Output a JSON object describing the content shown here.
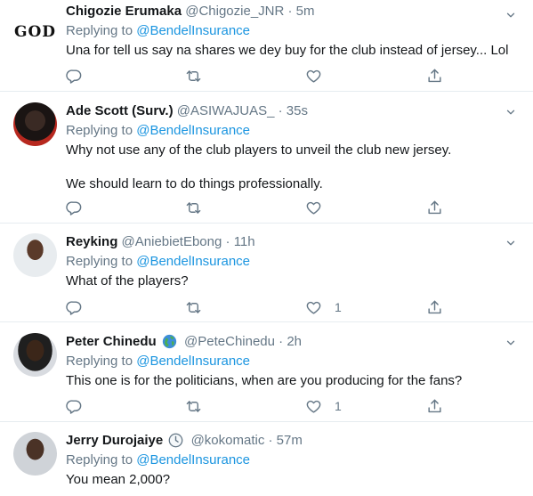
{
  "tweets": [
    {
      "name": "Chigozie Erumaka",
      "handle": "@Chigozie_JNR",
      "dot": "·",
      "time": "5m",
      "avatar_text": "GOD",
      "replying_prefix": "Replying to",
      "replying_to": "@BendelInsurance",
      "lines": [
        "Una for tell us say na shares we dey buy for the club instead of jersey... Lol"
      ],
      "likes": ""
    },
    {
      "name": "Ade Scott (Surv.)",
      "handle": "@ASIWAJUAS_",
      "dot": "·",
      "time": "35s",
      "replying_prefix": "Replying to",
      "replying_to": "@BendelInsurance",
      "lines": [
        "Why not use any of the club players to unveil the club new jersey.",
        "We should learn to do things professionally."
      ],
      "likes": ""
    },
    {
      "name": "Reyking",
      "handle": "@AniebietEbong",
      "dot": "·",
      "time": "11h",
      "replying_prefix": "Replying to",
      "replying_to": "@BendelInsurance",
      "lines": [
        "What of the players?"
      ],
      "likes": "1"
    },
    {
      "name": "Peter Chinedu",
      "handle": "@PeteChinedu",
      "dot": "·",
      "time": "2h",
      "badge": "globe-icon",
      "replying_prefix": "Replying to",
      "replying_to": "@BendelInsurance",
      "lines": [
        "This one is for the politicians, when are you producing for the fans?"
      ],
      "likes": "1"
    },
    {
      "name": "Jerry Durojaiye",
      "handle": "@kokomatic",
      "dot": "·",
      "time": "57m",
      "badge": "clock-icon",
      "replying_prefix": "Replying to",
      "replying_to": "@BendelInsurance",
      "lines": [
        "You mean 2,000?"
      ],
      "likes": ""
    }
  ],
  "colors": {
    "name": "#14171a",
    "muted": "#657786",
    "link": "#1b95e0",
    "divider": "#e6ecf0"
  }
}
